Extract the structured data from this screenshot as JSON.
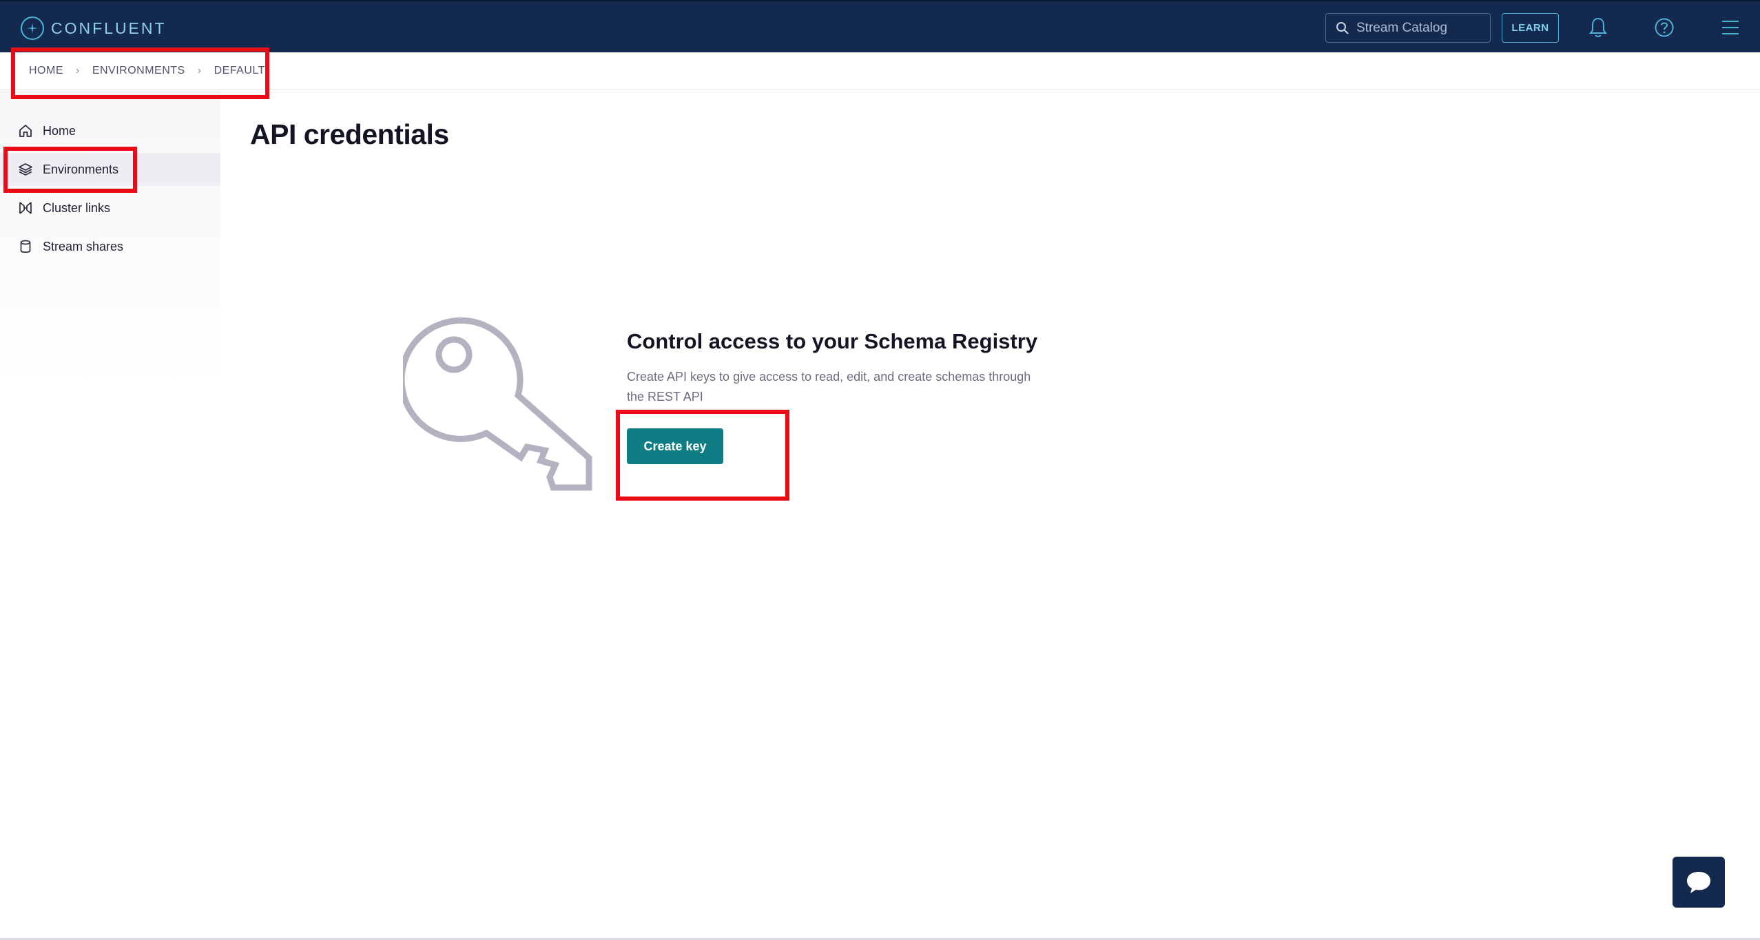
{
  "header": {
    "logo_text": "CONFLUENT",
    "search_placeholder": "Stream Catalog",
    "learn_label": "LEARN",
    "icons": [
      "bell-icon",
      "help-icon",
      "menu-icon"
    ]
  },
  "breadcrumb": {
    "items": [
      "HOME",
      "ENVIRONMENTS",
      "DEFAULT"
    ]
  },
  "sidebar": {
    "items": [
      {
        "label": "Home",
        "icon": "home-icon",
        "active": false
      },
      {
        "label": "Environments",
        "icon": "layers-icon",
        "active": true
      },
      {
        "label": "Cluster links",
        "icon": "cluster-links-icon",
        "active": false
      },
      {
        "label": "Stream shares",
        "icon": "database-icon",
        "active": false
      }
    ]
  },
  "main": {
    "title": "API credentials",
    "empty_state": {
      "heading": "Control access to your Schema Registry",
      "description": "Create API keys to give access to read, edit, and create schemas through the REST API",
      "button_label": "Create key",
      "illustration": "key-icon"
    }
  },
  "colors": {
    "topbar": "#14294e",
    "accent": "#0f7d84",
    "highlight": "#ea0b16"
  }
}
